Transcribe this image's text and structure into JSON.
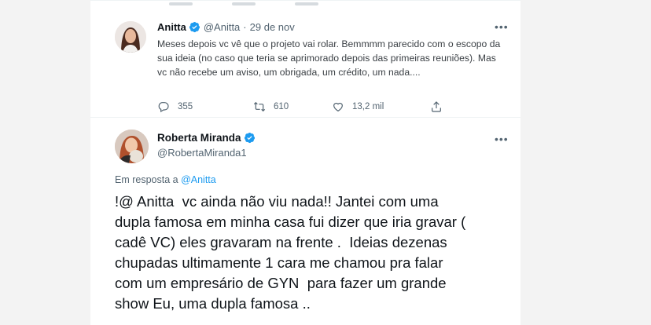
{
  "tweet1": {
    "name": "Anitta",
    "handle": "@Anitta",
    "separator": "·",
    "date": "29 de nov",
    "text": "Meses depois vc vê que o projeto vai rolar. Bemmmm parecido com o escopo da sua ideia (no caso que teria se aprimorado depois das primeiras reuniões). Mas vc não recebe um aviso, um obrigada, um crédito, um nada....",
    "replies": "355",
    "retweets": "610",
    "likes": "13,2 mil",
    "icons": [
      "verified-badge-icon",
      "more-options-icon",
      "reply-icon",
      "retweet-icon",
      "like-icon",
      "share-icon"
    ]
  },
  "tweet2": {
    "name": "Roberta Miranda",
    "handle": "@RobertaMiranda1",
    "replying_prefix": "Em resposta a ",
    "replying_to": "@Anitta",
    "text": "!@ Anitta  vc ainda não viu nada!! Jantei com uma\ndupla famosa em minha casa fui dizer que iria gravar (\ncadê VC) eles gravaram na frente .  Ideias dezenas\nchupadas ultimamente 1 cara me chamou pra falar\ncom um empresário de GYN  para fazer um grande\nshow Eu, uma dupla famosa ..",
    "icons": [
      "verified-badge-icon",
      "more-options-icon"
    ]
  },
  "colors": {
    "accent": "#1d9bf0",
    "text": "#0f1419",
    "secondary": "#536471",
    "background": "#f3f3f3"
  }
}
